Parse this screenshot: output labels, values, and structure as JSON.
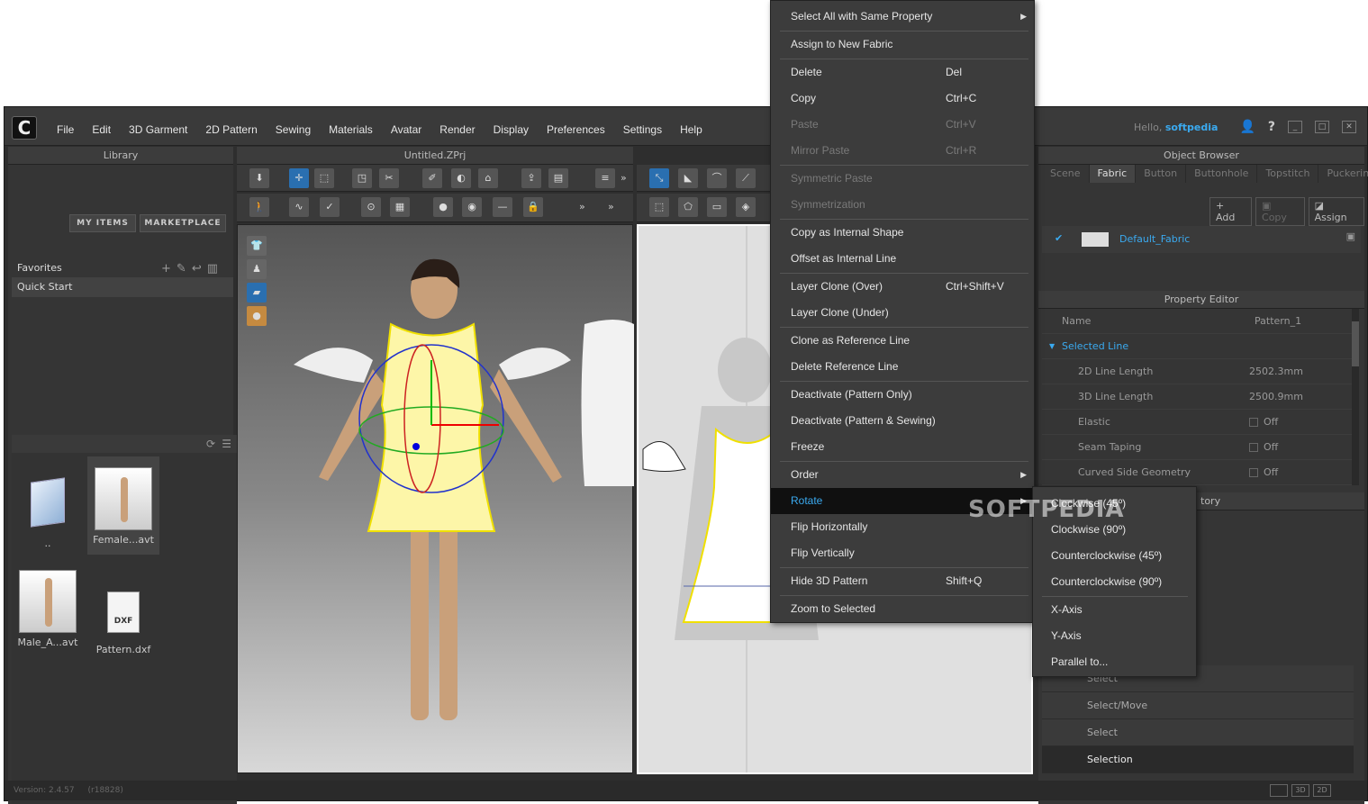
{
  "menubar": {
    "logo": "C",
    "items": [
      "File",
      "Edit",
      "3D Garment",
      "2D Pattern",
      "Sewing",
      "Materials",
      "Avatar",
      "Render",
      "Display",
      "Preferences",
      "Settings",
      "Help"
    ],
    "hello": "Hello,",
    "user": "softpedia"
  },
  "library": {
    "title": "Library",
    "my_items": "MY ITEMS",
    "marketplace": "MARKETPLACE",
    "favorites": "Favorites",
    "quick_start": "Quick Start",
    "files": [
      {
        "name": ".."
      },
      {
        "name": "Female...avt"
      },
      {
        "name": "Male_A...avt"
      },
      {
        "name": "Pattern.dxf",
        "badge": "DXF"
      }
    ]
  },
  "viewport": {
    "title": "Untitled.ZPrj",
    "more": "»"
  },
  "object_browser": {
    "title": "Object Browser",
    "tabs": [
      "Scene",
      "Fabric",
      "Button",
      "Buttonhole",
      "Topstitch",
      "Puckering"
    ],
    "active_tab": "Fabric",
    "add": "Add",
    "copy": "Copy",
    "assign": "Assign",
    "fabric": "Default_Fabric"
  },
  "property_editor": {
    "title": "Property Editor",
    "name_label": "Name",
    "name_value": "Pattern_1",
    "section": "Selected Line",
    "rows": [
      {
        "k": "2D Line Length",
        "v": "2502.3mm"
      },
      {
        "k": "3D Line Length",
        "v": "2500.9mm"
      },
      {
        "k": "Elastic",
        "v": "Off"
      },
      {
        "k": "Seam Taping",
        "v": "Off"
      },
      {
        "k": "Curved Side Geometry",
        "v": "Off"
      }
    ]
  },
  "history": {
    "title_partial": "tory",
    "items": [
      "Select",
      "Select/Move",
      "Select",
      "Selection"
    ]
  },
  "context_menu": {
    "items": [
      {
        "label": "Select All with Same Property",
        "arrow": "▶"
      },
      {
        "label": "Assign to New Fabric"
      },
      {
        "label": "Delete",
        "shortcut": "Del"
      },
      {
        "label": "Copy",
        "shortcut": "Ctrl+C"
      },
      {
        "label": "Paste",
        "shortcut": "Ctrl+V",
        "disabled": true
      },
      {
        "label": "Mirror Paste",
        "shortcut": "Ctrl+R",
        "disabled": true
      },
      {
        "label": "Symmetric Paste",
        "disabled": true
      },
      {
        "label": "Symmetrization",
        "disabled": true
      },
      {
        "label": "Copy as Internal Shape"
      },
      {
        "label": "Offset as Internal Line"
      },
      {
        "label": "Layer Clone (Over)",
        "shortcut": "Ctrl+Shift+V"
      },
      {
        "label": "Layer Clone (Under)"
      },
      {
        "label": "Clone as Reference Line"
      },
      {
        "label": "Delete Reference Line"
      },
      {
        "label": "Deactivate (Pattern Only)"
      },
      {
        "label": "Deactivate (Pattern & Sewing)"
      },
      {
        "label": "Freeze"
      },
      {
        "label": "Order",
        "arrow": "▶"
      },
      {
        "label": "Rotate",
        "arrow": "▶",
        "highlighted": true
      },
      {
        "label": "Flip Horizontally"
      },
      {
        "label": "Flip Vertically"
      },
      {
        "label": "Hide 3D Pattern",
        "shortcut": "Shift+Q"
      },
      {
        "label": "Zoom to Selected"
      }
    ]
  },
  "rotate_submenu": [
    "Clockwise (45º)",
    "Clockwise (90º)",
    "Counterclockwise (45º)",
    "Counterclockwise (90º)",
    "X-Axis",
    "Y-Axis",
    "Parallel to..."
  ],
  "watermark": "SOFTPEDIA",
  "status": {
    "version": "Version: 2.4.57",
    "build": "(r18828)"
  },
  "colors": {
    "accent": "#3aaaf0",
    "highlight_bg": "#101010",
    "garment": "#fdf6a8"
  }
}
